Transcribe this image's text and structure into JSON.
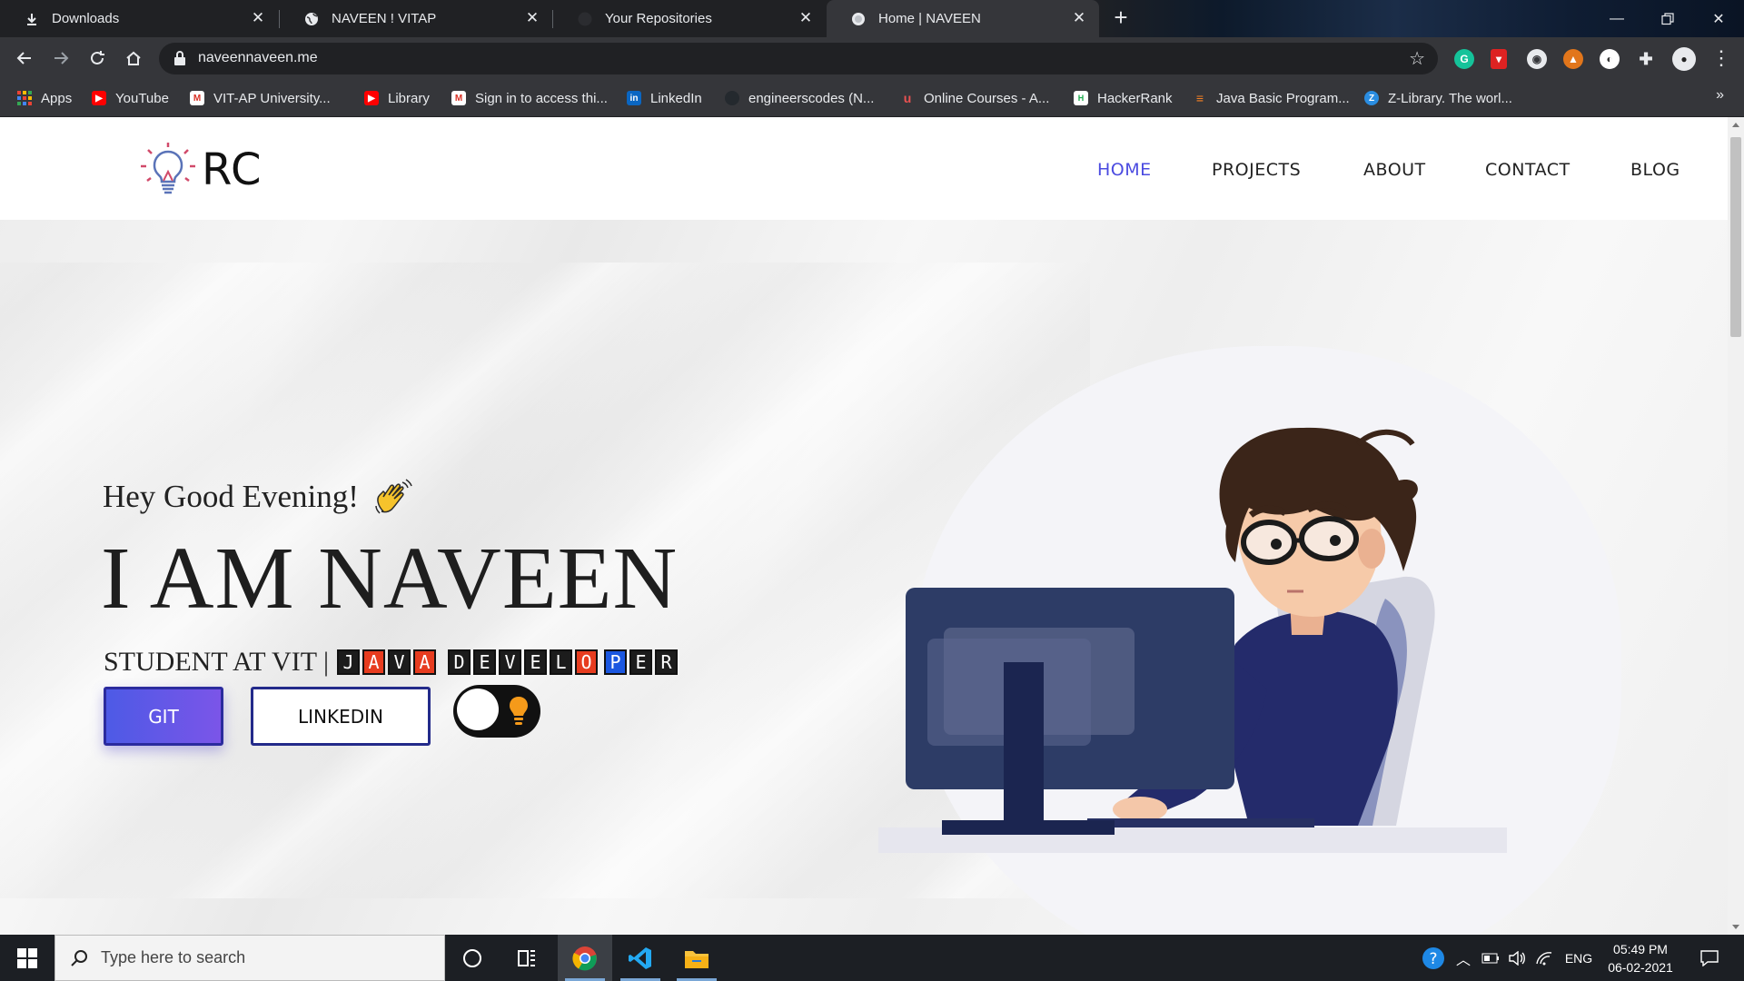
{
  "browser": {
    "tabs": [
      {
        "title": "Downloads",
        "icon": "download-icon"
      },
      {
        "title": "NAVEEN ! VITAP",
        "icon": "globe-icon"
      },
      {
        "title": "Your Repositories",
        "icon": "github-icon"
      },
      {
        "title": "Home | NAVEEN",
        "icon": "globe-icon",
        "active": true
      }
    ],
    "url": "naveennaveen.me",
    "bookmarks": [
      {
        "label": "Apps",
        "icon": "apps-grid-icon"
      },
      {
        "label": "YouTube",
        "icon": "youtube-icon"
      },
      {
        "label": "VIT-AP University...",
        "icon": "gmail-icon"
      },
      {
        "label": "Library",
        "icon": "youtube-icon"
      },
      {
        "label": "Sign in to access thi...",
        "icon": "gmail-icon"
      },
      {
        "label": "LinkedIn",
        "icon": "linkedin-icon"
      },
      {
        "label": "engineerscodes (N...",
        "icon": "github-icon"
      },
      {
        "label": "Online Courses - A...",
        "icon": "udemy-icon"
      },
      {
        "label": "HackerRank",
        "icon": "hackerrank-icon"
      },
      {
        "label": "Java Basic Program...",
        "icon": "stackoverflow-icon"
      },
      {
        "label": "Z-Library. The worl...",
        "icon": "zlibrary-icon"
      }
    ]
  },
  "site": {
    "logo_text": "RC",
    "nav": [
      "HOME",
      "PROJECTS",
      "ABOUT",
      "CONTACT",
      "BLOG"
    ],
    "active_nav": "HOME",
    "greeting": "Hey Good Evening!",
    "headline": "I AM NAVEEN",
    "subtitle_prefix": "STUDENT AT VIT |",
    "role_word_1": [
      "J",
      "A",
      "V",
      "A"
    ],
    "role_word_2": [
      "D",
      "E",
      "V",
      "E",
      "L",
      "O",
      "P",
      "E",
      "R"
    ],
    "buttons": {
      "git": "GIT",
      "linkedin": "LINKEDIN"
    },
    "accent_color": "#4b4be0"
  },
  "taskbar": {
    "search_placeholder": "Type here to search",
    "language": "ENG",
    "time": "05:49 PM",
    "date": "06-02-2021"
  }
}
